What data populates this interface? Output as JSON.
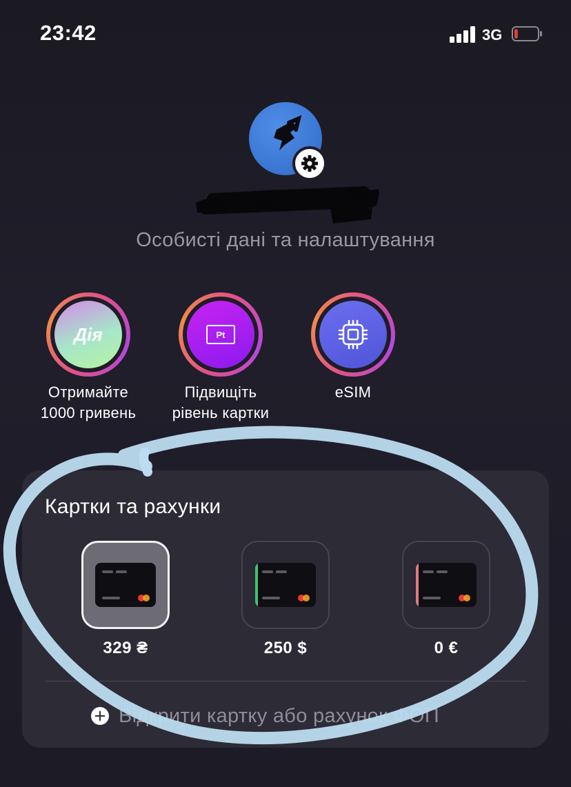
{
  "status_bar": {
    "time": "23:42",
    "network": "3G",
    "battery_level": 0.15,
    "battery_color": "#e0413a"
  },
  "profile": {
    "avatar_color": "#3a7be0",
    "settings_link": "Особисті дані та налаштування"
  },
  "quick_actions": [
    {
      "icon": "Дія",
      "label_line1": "Отримайте",
      "label_line2": "1000 гривень"
    },
    {
      "icon": "Pt",
      "label_line1": "Підвищіть",
      "label_line2": "рівень картки"
    },
    {
      "icon": "esim-chip-icon",
      "label_line1": "eSIM",
      "label_line2": ""
    }
  ],
  "cards_section": {
    "title": "Картки та рахунки",
    "cards": [
      {
        "amount": "329 ₴",
        "stripe_color": "",
        "selected": true
      },
      {
        "amount": "250 $",
        "stripe_color": "#3ec46d",
        "selected": false
      },
      {
        "amount": "0 €",
        "stripe_color": "#e07c7c",
        "selected": false
      }
    ],
    "open_account_label": "Відкрити картку або рахунок ФОП"
  },
  "colors": {
    "background": "#1e1c26",
    "panel": "#2d2b36",
    "muted_text": "#9a98a4",
    "annotation_stroke": "#bcdcf0"
  }
}
